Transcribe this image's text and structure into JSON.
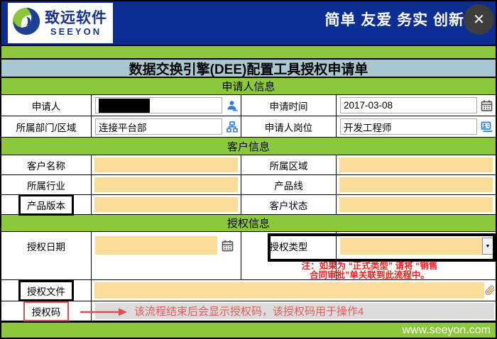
{
  "header": {
    "brand": "致远软件",
    "brand_sub": "SEEYON",
    "slogan": "简单 友爱 务实 创新",
    "close_glyph": "✕"
  },
  "form_title": "数据交换引擎(DEE)配置工具授权申请单",
  "applicant": {
    "section": "申请人信息",
    "name_label": "申请人",
    "name_value": "",
    "time_label": "申请时间",
    "time_value": "2017-03-08",
    "dept_label": "所属部门/区域",
    "dept_value": "连接平台部",
    "position_label": "申请人岗位",
    "position_value": "开发工程师"
  },
  "customer": {
    "section": "客户信息",
    "name_label": "客户名称",
    "region_label": "所属区域",
    "industry_label": "所属行业",
    "product_line_label": "产品线",
    "version_label": "产品版本",
    "status_label": "客户状态"
  },
  "auth": {
    "section": "授权信息",
    "date_label": "授权日期",
    "type_label": "授权类型",
    "type_dropdown_glyph": "▼",
    "note_line1": "注：如果为 “正式类型” 请将 “销售",
    "note_line2": "合同审批”单关联到此流程中。",
    "file_label": "授权文件",
    "code_label": "授权码",
    "code_note": "该流程结束后会显示授权码，该授权码用于操作4"
  },
  "footer": {
    "site": "www.seeyon.com"
  },
  "colors": {
    "header_blue": "#0c2d94",
    "green": "#8cc83c",
    "title_bar": "#a9c7d1",
    "field_yellow": "#fbdc98",
    "field_gray": "#dcdcdc",
    "note_red": "#ff1a1a",
    "code_red": "#e85a5a",
    "icon_blue": "#2e7ce0"
  }
}
